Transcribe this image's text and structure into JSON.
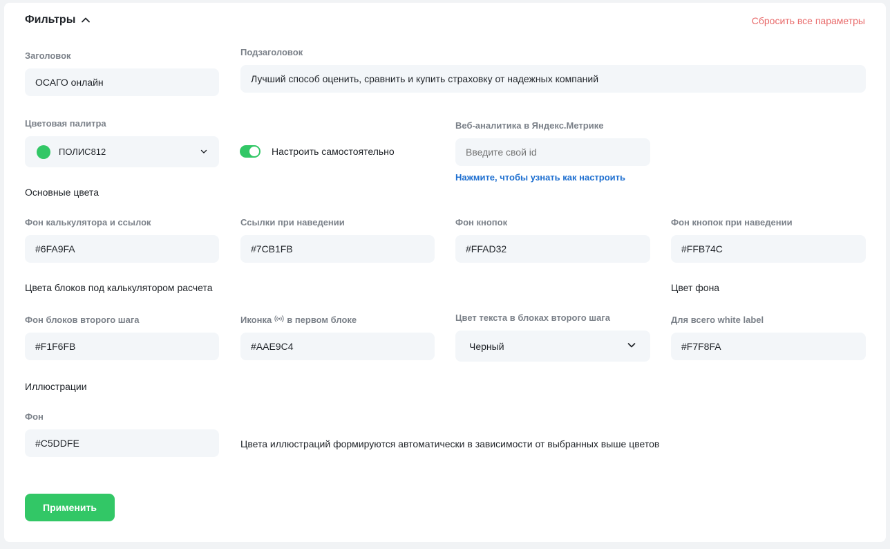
{
  "filters": {
    "title": "Фильтры",
    "reset_label": "Сбросить все параметры"
  },
  "heading": {
    "label": "Заголовок",
    "value": "ОСАГО онлайн"
  },
  "subheading": {
    "label": "Подзаголовок",
    "value": "Лучший способ оценить, сравнить и купить страховку от надежных компаний"
  },
  "palette": {
    "label": "Цветовая палитра",
    "value": "ПОЛИС812",
    "color": "#32C766",
    "icon": "chevron-down-icon"
  },
  "custom_toggle": {
    "label": "Настроить самостоятельно",
    "checked": true
  },
  "metrika": {
    "label": "Веб-аналитика в Яндекс.Метрике",
    "placeholder": "Введите свой id",
    "help_link": "Нажмите, чтобы узнать как настроить"
  },
  "main_colors": {
    "section_title": "Основные цвета",
    "fields": [
      {
        "label": "Фон калькулятора и ссылок",
        "value": "#6FA9FA"
      },
      {
        "label": "Ссылки при наведении",
        "value": "#7CB1FB"
      },
      {
        "label": "Фон кнопок",
        "value": "#FFAD32"
      },
      {
        "label": "Фон кнопок при наведении",
        "value": "#FFB74C"
      }
    ]
  },
  "block_colors": {
    "section_title": "Цвета блоков под калькулятором расчета",
    "second_step_bg": {
      "label": "Фон блоков второго шага",
      "value": "#F1F6FB"
    },
    "icon_first_block": {
      "label_before": "Иконка",
      "label_after": "в первом блоке",
      "icon": "broadcast-icon",
      "value": "#AAE9C4"
    },
    "text_color": {
      "label": "Цвет текста в блоках второго шага",
      "value": "Черный"
    }
  },
  "background": {
    "section_title": "Цвет фона",
    "label": "Для всего white label",
    "value": "#F7F8FA"
  },
  "illustrations": {
    "section_title": "Иллюстрации",
    "label": "Фон",
    "value": "#C5DDFE",
    "note": "Цвета иллюстраций формируются автоматически в зависимости от выбранных выше цветов"
  },
  "apply_label": "Применить"
}
